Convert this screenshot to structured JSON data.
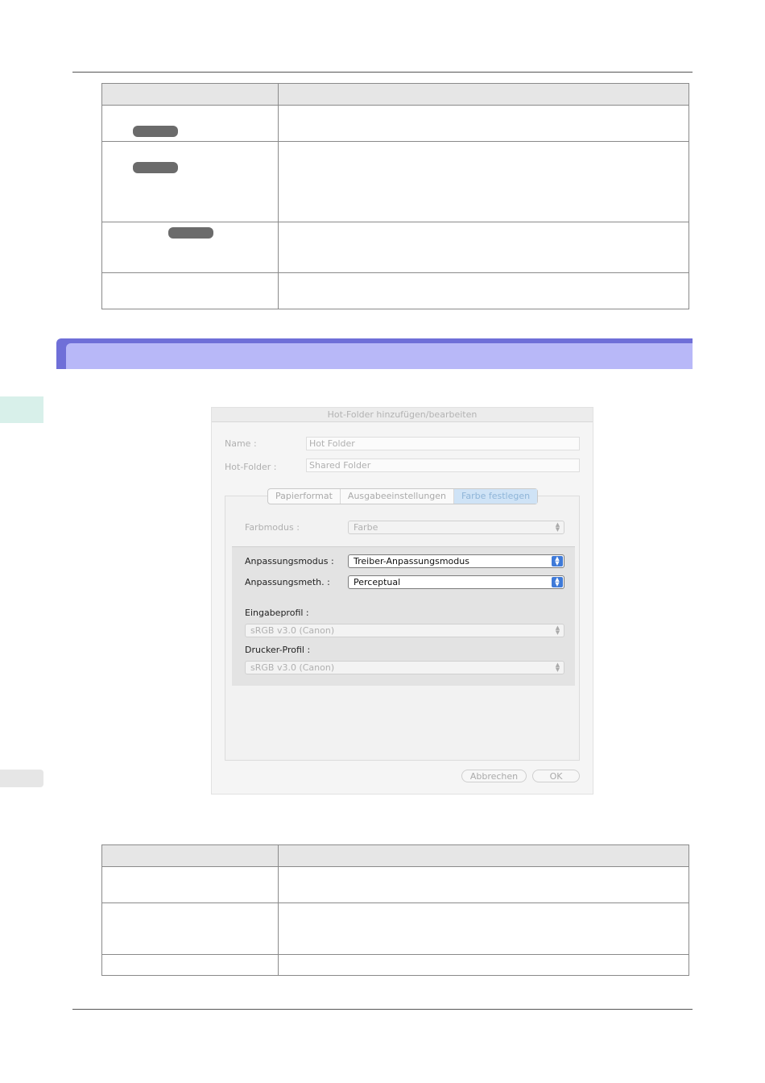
{
  "dialog": {
    "title": "Hot-Folder hinzufügen/bearbeiten",
    "name_label": "Name :",
    "name_value": "Hot Folder",
    "hotfolder_label": "Hot-Folder :",
    "hotfolder_value": "Shared Folder",
    "tabs": [
      {
        "label": "Papierformat"
      },
      {
        "label": "Ausgabeeinstellungen"
      },
      {
        "label": "Farbe festlegen"
      }
    ],
    "farbmodus_label": "Farbmodus :",
    "farbmodus_value": "Farbe",
    "anpassungsmodus_label": "Anpassungsmodus :",
    "anpassungsmodus_value": "Treiber-Anpassungsmodus",
    "anpassungsmeth_label": "Anpassungsmeth. :",
    "anpassungsmeth_value": "Perceptual",
    "eingabeprofil_label": "Eingabeprofil :",
    "eingabeprofil_value": "sRGB v3.0 (Canon)",
    "druckerprofil_label": "Drucker-Profil :",
    "druckerprofil_value": "sRGB v3.0 (Canon)",
    "cancel_label": "Abbrechen",
    "ok_label": "OK"
  },
  "colors": {
    "section_dark": "#6f6fd8",
    "section_light": "#b8b8f8",
    "side_tab": "#d8f0ea",
    "select_accent": "#3f7ad8"
  }
}
